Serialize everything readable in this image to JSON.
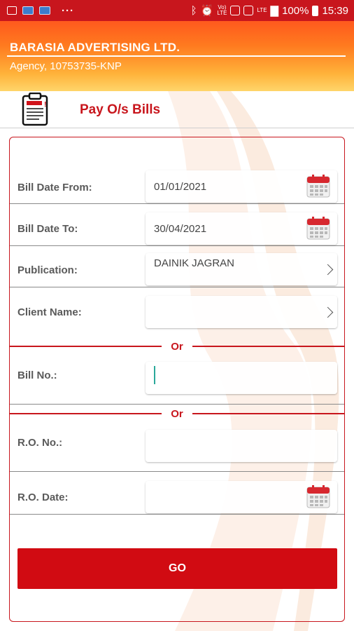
{
  "status_bar": {
    "notification_icons": [
      "gallery-icon",
      "app-icon",
      "app-icon"
    ],
    "overflow": "···",
    "network_label_1": "Vo)",
    "network_label_2": "LTE",
    "lte_label": "LTE",
    "battery_percent": "100%",
    "time": "15:39"
  },
  "header": {
    "company": "BARASIA ADVERTISING LTD.",
    "agency": "Agency,  10753735-KNP"
  },
  "page": {
    "title": "Pay O/s Bills",
    "icon_label": "INVOICE"
  },
  "form": {
    "bill_date_from": {
      "label": "Bill Date From:",
      "value": "01/01/2021"
    },
    "bill_date_to": {
      "label": "Bill Date To:",
      "value": "30/04/2021"
    },
    "publication": {
      "label": "Publication:",
      "value": "DAINIK JAGRAN"
    },
    "client_name": {
      "label": "Client Name:",
      "value": ""
    },
    "or_1": "Or",
    "bill_no": {
      "label": "Bill No.:",
      "value": ""
    },
    "or_2": "Or",
    "ro_no": {
      "label": "R.O. No.:",
      "value": ""
    },
    "ro_date": {
      "label": "R.O. Date:",
      "value": ""
    },
    "go_label": "GO"
  },
  "colors": {
    "brand_red": "#c8161d",
    "header_orange": "#ff7a1f",
    "header_yellow": "#ffd56a"
  }
}
